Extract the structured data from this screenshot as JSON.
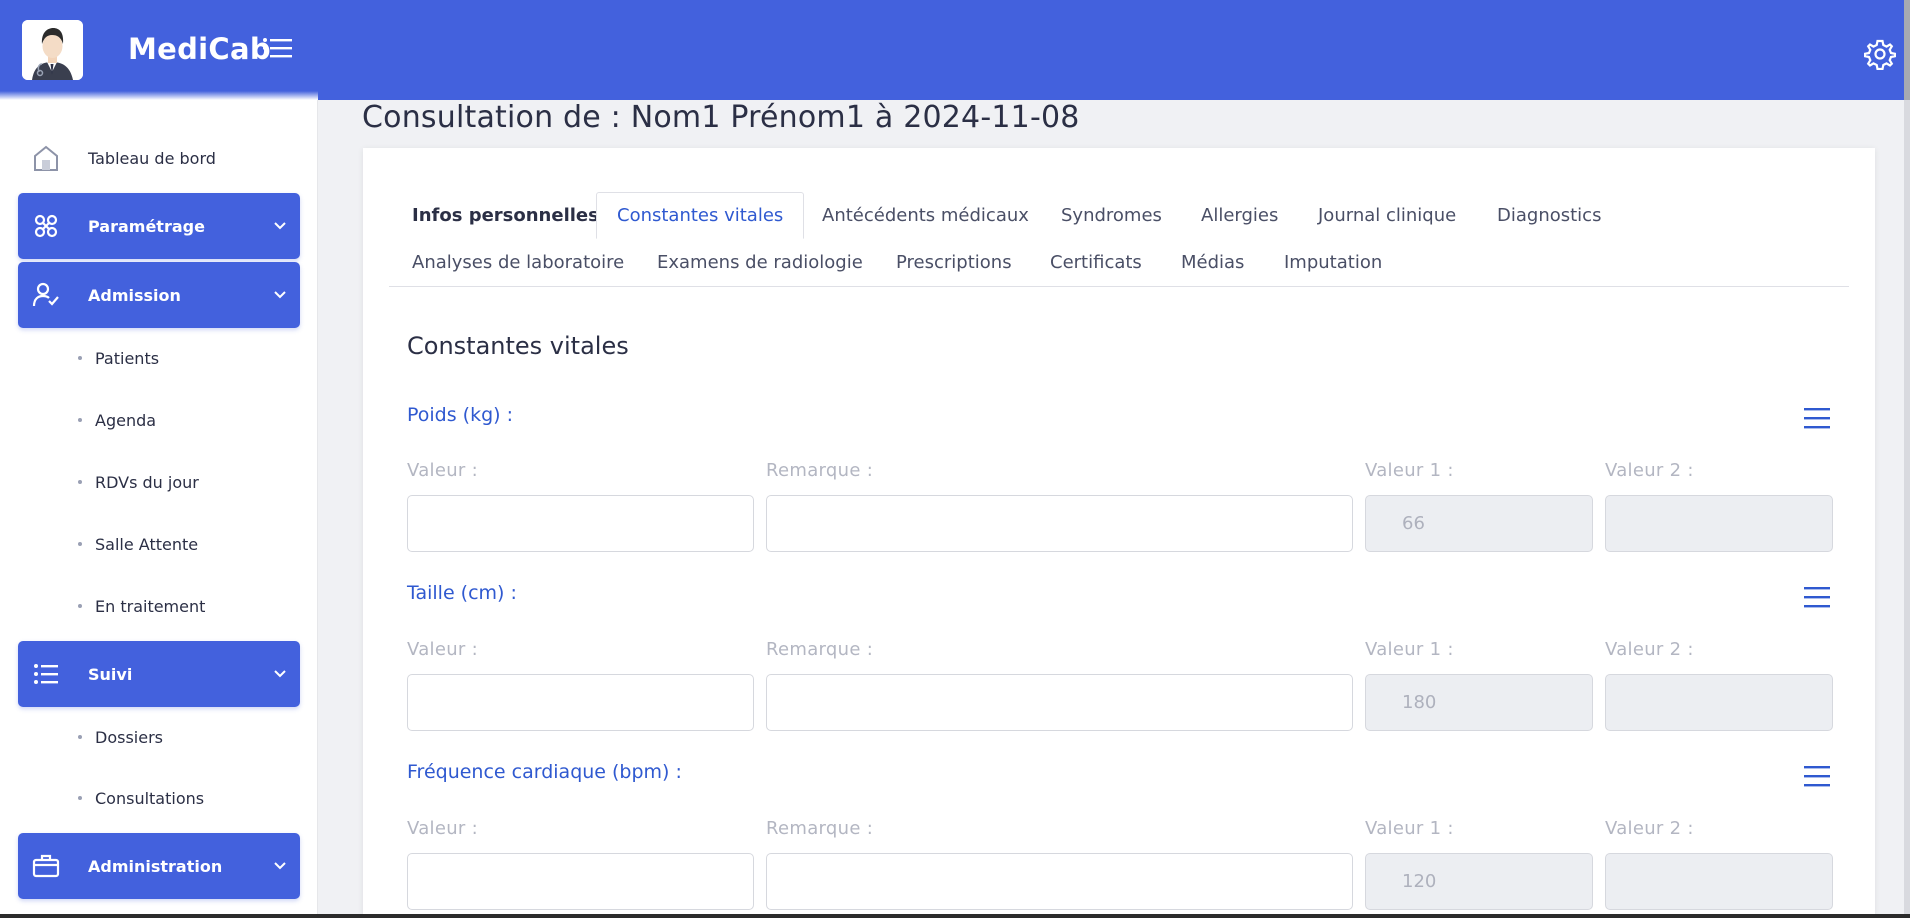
{
  "app": {
    "name": "MediCab"
  },
  "sidebar": {
    "dashboard": "Tableau de bord",
    "groups": {
      "parametrage": "Paramétrage",
      "admission": "Admission",
      "suivi": "Suivi",
      "administration": "Administration"
    },
    "admission_items": [
      "Patients",
      "Agenda",
      "RDVs du jour",
      "Salle Attente",
      "En traitement"
    ],
    "suivi_items": [
      "Dossiers",
      "Consultations"
    ]
  },
  "page": {
    "title": "Consultation de : Nom1 Prénom1 à 2024-11-08"
  },
  "tabs": {
    "row1": [
      "Infos personnelles",
      "Constantes vitales",
      "Antécédents médicaux",
      "Syndromes",
      "Allergies",
      "Journal clinique",
      "Diagnostics"
    ],
    "row2": [
      "Analyses de laboratoire",
      "Examens de radiologie",
      "Prescriptions",
      "Certificats",
      "Médias",
      "Imputation"
    ],
    "active": "Constantes vitales"
  },
  "section": {
    "title": "Constantes vitales"
  },
  "fields": {
    "valeur": "Valeur :",
    "remarque": "Remarque :",
    "valeur1": "Valeur 1 :",
    "valeur2": "Valeur 2 :"
  },
  "vitals": [
    {
      "label": "Poids (kg) :",
      "valeur1": "66",
      "valeur2": ""
    },
    {
      "label": "Taille (cm) :",
      "valeur1": "180",
      "valeur2": ""
    },
    {
      "label": "Fréquence cardiaque (bpm) :",
      "valeur1": "120",
      "valeur2": ""
    }
  ],
  "colors": {
    "primary": "#4361dd",
    "accent_text": "#2f59d0"
  },
  "icons": {
    "dashboard": "home-icon",
    "parametrage": "puzzle-icon",
    "admission": "user-check-icon",
    "suivi": "list-icon",
    "administration": "briefcase-icon",
    "settings": "gear-icon",
    "vital_menu": "hamburger-icon"
  }
}
